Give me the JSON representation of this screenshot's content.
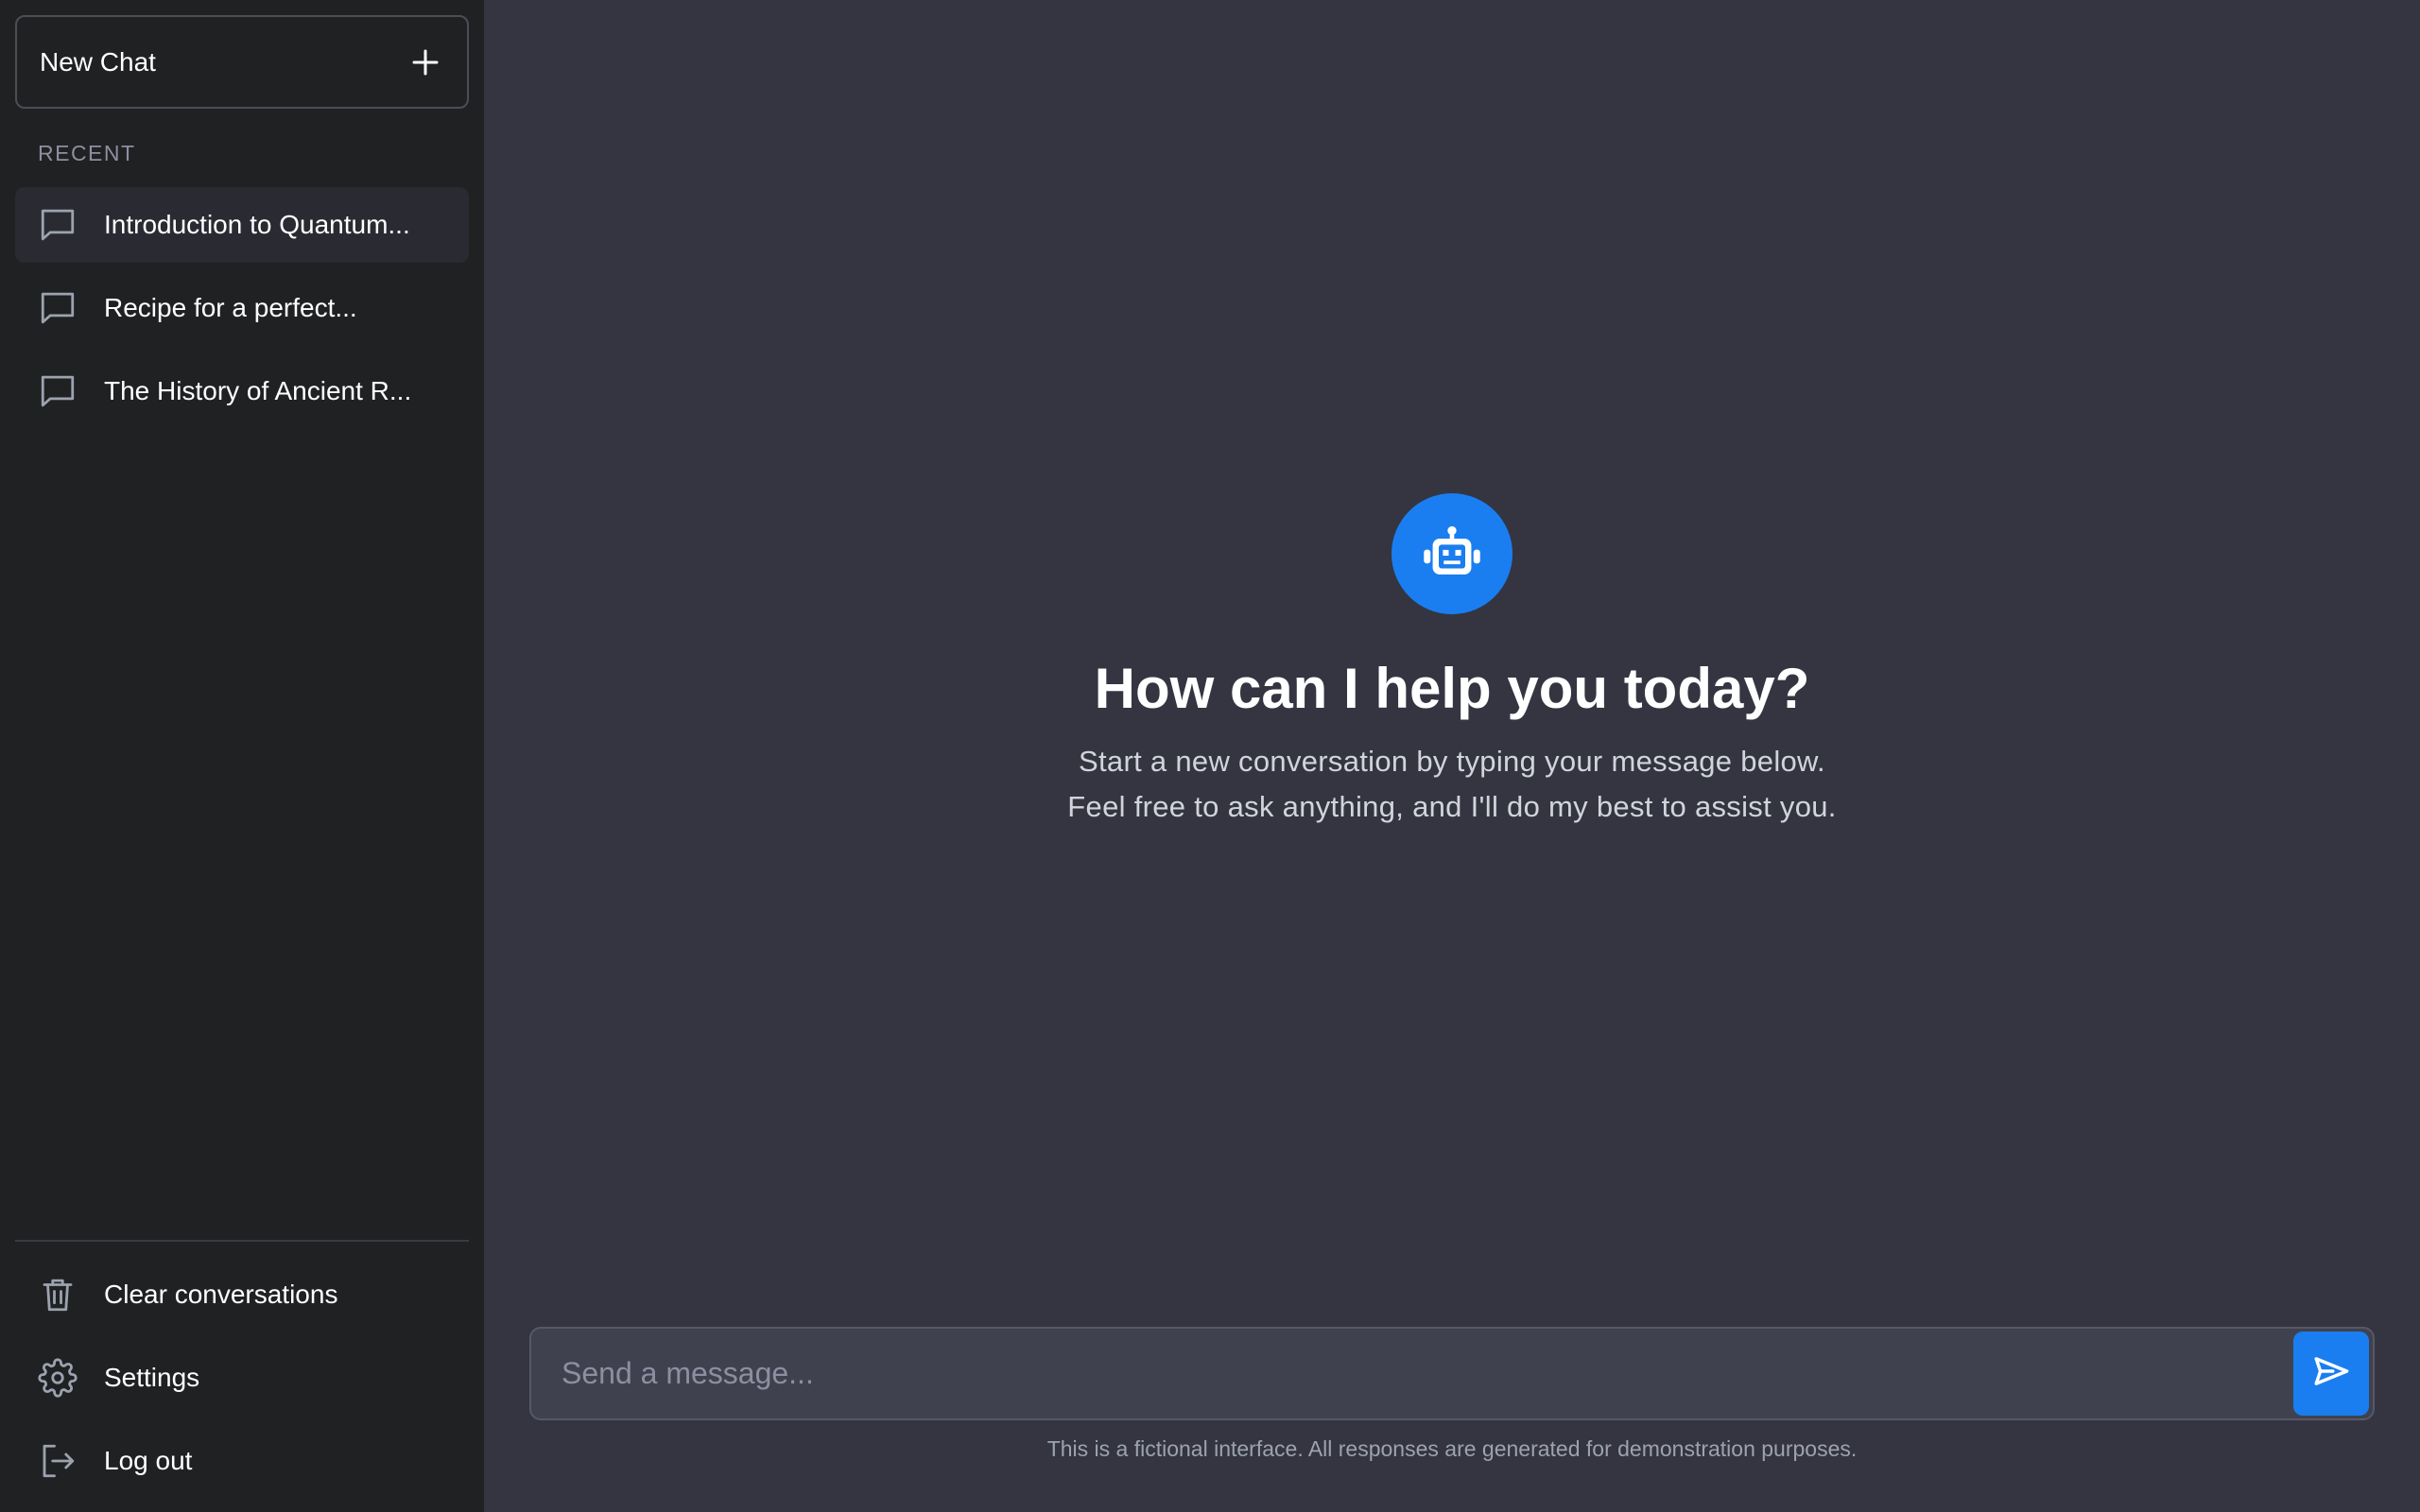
{
  "sidebar": {
    "new_chat_label": "New Chat",
    "recent_header": "RECENT",
    "conversations": [
      {
        "label": "Introduction to Quantum...",
        "active": true
      },
      {
        "label": "Recipe for a perfect...",
        "active": false
      },
      {
        "label": "The History of Ancient R...",
        "active": false
      }
    ],
    "footer": {
      "clear_label": "Clear conversations",
      "settings_label": "Settings",
      "logout_label": "Log out"
    }
  },
  "main": {
    "title": "How can I help you today?",
    "subtitle_line1": "Start a new conversation by typing your message below.",
    "subtitle_line2": "Feel free to ask anything, and I'll do my best to assist you.",
    "input_placeholder": "Send a message...",
    "disclaimer": "This is a fictional interface. All responses are generated for demonstration purposes."
  },
  "icons": {
    "new_chat": "plus-icon",
    "conversation": "chat-bubble-icon",
    "clear": "trash-icon",
    "settings": "gear-icon",
    "logout": "logout-icon",
    "avatar": "robot-icon",
    "send": "send-icon"
  },
  "colors": {
    "accent": "#1a7ef0",
    "sidebar_bg": "#202123",
    "main_bg": "#343541",
    "active_item_bg": "#2a2b32"
  }
}
